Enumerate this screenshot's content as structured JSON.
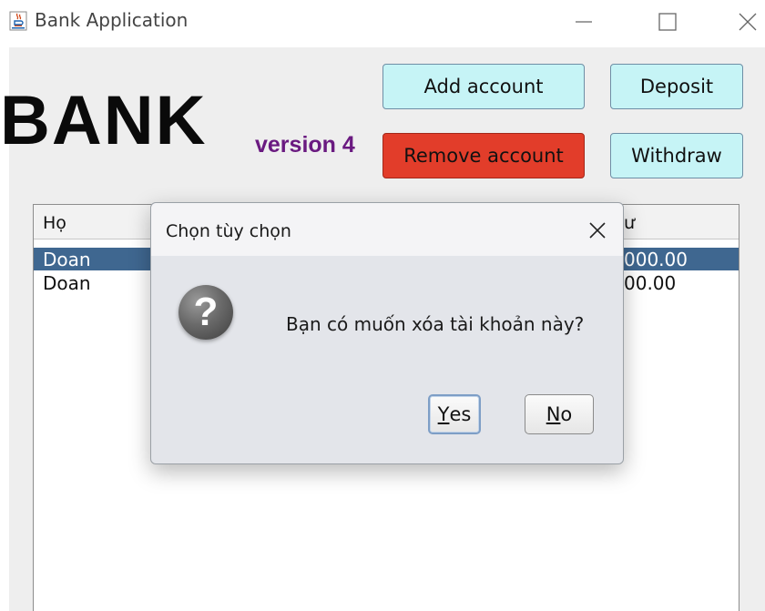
{
  "window": {
    "title": "Bank Application",
    "icon": "java-cup-icon"
  },
  "logo": {
    "bank": "BANK",
    "version": "version 4"
  },
  "toolbar": {
    "add_account": "Add account",
    "deposit": "Deposit",
    "remove_account": "Remove account",
    "withdraw": "Withdraw"
  },
  "colors": {
    "action_button": "#c6f4f6",
    "remove_button": "#e23d2a",
    "version_text": "#6a1a80",
    "selected_row": "#3f6790"
  },
  "table": {
    "headers": [
      "Họ",
      "ư"
    ],
    "rows": [
      {
        "ho": "Doan",
        "amount": "000.00",
        "selected": true
      },
      {
        "ho": "Doan",
        "amount": "00.00",
        "selected": false
      }
    ]
  },
  "dialog": {
    "title": "Chọn tùy chọn",
    "icon": "question-icon",
    "icon_glyph": "?",
    "message": "Bạn có muốn xóa tài khoản này?",
    "yes_mnemonic": "Y",
    "yes_rest": "es",
    "no_mnemonic": "N",
    "no_rest": "o"
  }
}
